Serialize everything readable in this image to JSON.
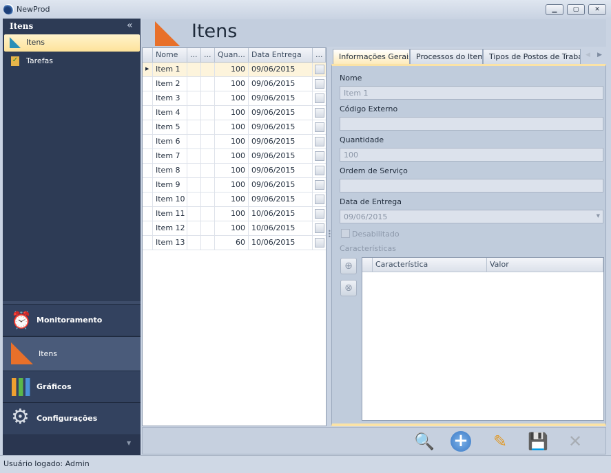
{
  "app": {
    "title": "NewProd",
    "window_controls": [
      "minimize",
      "restore",
      "close"
    ]
  },
  "sidebar": {
    "header": "Itens",
    "collapse_icon": "double-chevron-left",
    "items": [
      {
        "label": "Itens",
        "icon": "item-triangle-icon",
        "selected": true
      },
      {
        "label": "Tarefas",
        "icon": "clipboard-check-icon"
      }
    ],
    "groups": [
      {
        "label": "Monitoramento",
        "icon": "clock-ruler-icon"
      },
      {
        "label": "Itens",
        "icon": "item-triangle-icon",
        "selected": true
      },
      {
        "label": "Gráficos",
        "icon": "bar-chart-icon"
      },
      {
        "label": "Configurações",
        "icon": "gear-icon"
      }
    ]
  },
  "main": {
    "title": "Itens",
    "grid": {
      "columns": [
        "Nome",
        "...",
        "...",
        "Quan...",
        "Data Entrega",
        "..."
      ],
      "rows": [
        [
          "Item 1",
          "100",
          "09/06/2015"
        ],
        [
          "Item 2",
          "100",
          "09/06/2015"
        ],
        [
          "Item 3",
          "100",
          "09/06/2015"
        ],
        [
          "Item 4",
          "100",
          "09/06/2015"
        ],
        [
          "Item 5",
          "100",
          "09/06/2015"
        ],
        [
          "Item 6",
          "100",
          "09/06/2015"
        ],
        [
          "Item 7",
          "100",
          "09/06/2015"
        ],
        [
          "Item 8",
          "100",
          "09/06/2015"
        ],
        [
          "Item 9",
          "100",
          "09/06/2015"
        ],
        [
          "Item 10",
          "100",
          "09/06/2015"
        ],
        [
          "Item 11",
          "100",
          "10/06/2015"
        ],
        [
          "Item 12",
          "100",
          "10/06/2015"
        ],
        [
          "Item 13",
          "60",
          "10/06/2015"
        ]
      ],
      "selected_row": 0
    },
    "tabs": [
      "Informações Gerais",
      "Processos do Item",
      "Tipos de Postos de Trabalho"
    ],
    "form": {
      "nome_label": "Nome",
      "nome_value": "Item 1",
      "codigo_label": "Código Externo",
      "codigo_value": "",
      "quantidade_label": "Quantidade",
      "quantidade_value": "100",
      "ordem_label": "Ordem de Serviço",
      "ordem_value": "",
      "data_label": "Data de Entrega",
      "data_value": "09/06/2015",
      "desabilitado_label": "Desabilitado",
      "caracteristicas_label": "Características",
      "char_columns": [
        "Característica",
        "Valor"
      ]
    },
    "toolbar": [
      "search-report",
      "add",
      "edit",
      "save",
      "cancel"
    ]
  },
  "status": {
    "text": "Usuário logado: Admin"
  },
  "colors": {
    "sidebar": "#2d3b55",
    "selection": "#fde29a",
    "accent_orange": "#e8702a"
  }
}
